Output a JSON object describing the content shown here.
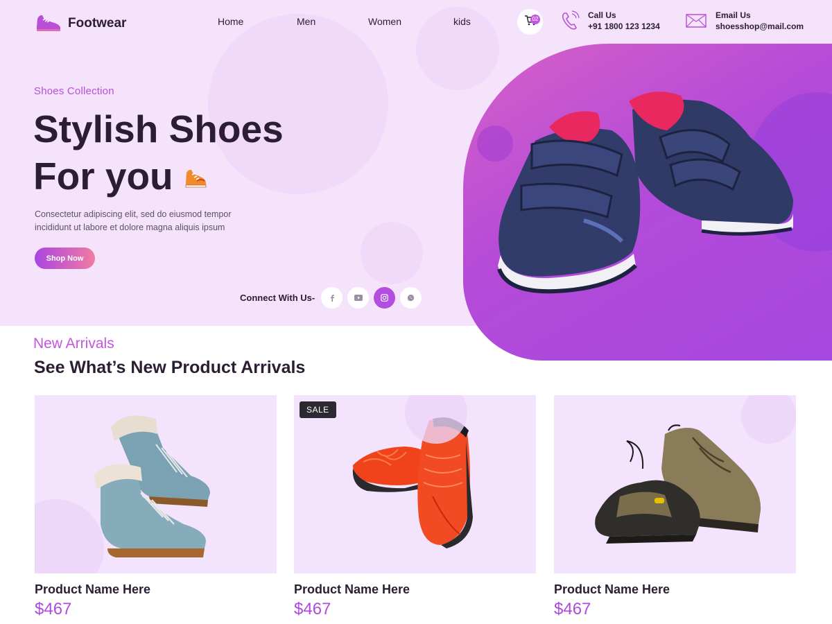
{
  "header": {
    "logo_text": "Footwear",
    "nav": [
      "Home",
      "Men",
      "Women",
      "kids"
    ],
    "cart_count": "02",
    "call": {
      "label": "Call Us",
      "value": "+91 1800 123 1234"
    },
    "email": {
      "label": "Email Us",
      "value": "shoesshop@mail.com"
    }
  },
  "hero": {
    "eyebrow": "Shoes Collection",
    "title_line1": "Stylish Shoes",
    "title_line2": "For you",
    "description": "Consectetur adipiscing elit, sed do eiusmod tempor incididunt ut labore et dolore magna aliquis ipsum",
    "cta": "Shop Now",
    "connect_label": "Connect With Us-",
    "social_icons": [
      "facebook-icon",
      "youtube-icon",
      "instagram-icon",
      "whatsapp-icon"
    ],
    "active_social": "instagram-icon"
  },
  "arrivals": {
    "eyebrow": "New Arrivals",
    "title": "See What’s New Product Arrivals",
    "products": [
      {
        "name": "Product Name Here",
        "price": "$467",
        "badge": "",
        "image": "blue-boots-image"
      },
      {
        "name": "Product Name Here",
        "price": "$467",
        "badge": "SALE",
        "image": "red-sneakers-image"
      },
      {
        "name": "Product Name Here",
        "price": "$467",
        "badge": "",
        "image": "hiking-shoes-image"
      }
    ]
  },
  "colors": {
    "accent": "#b94fd6",
    "hero_bg": "#f4e3fb",
    "gradient_start": "#a945e0",
    "gradient_end": "#f27ba3"
  }
}
